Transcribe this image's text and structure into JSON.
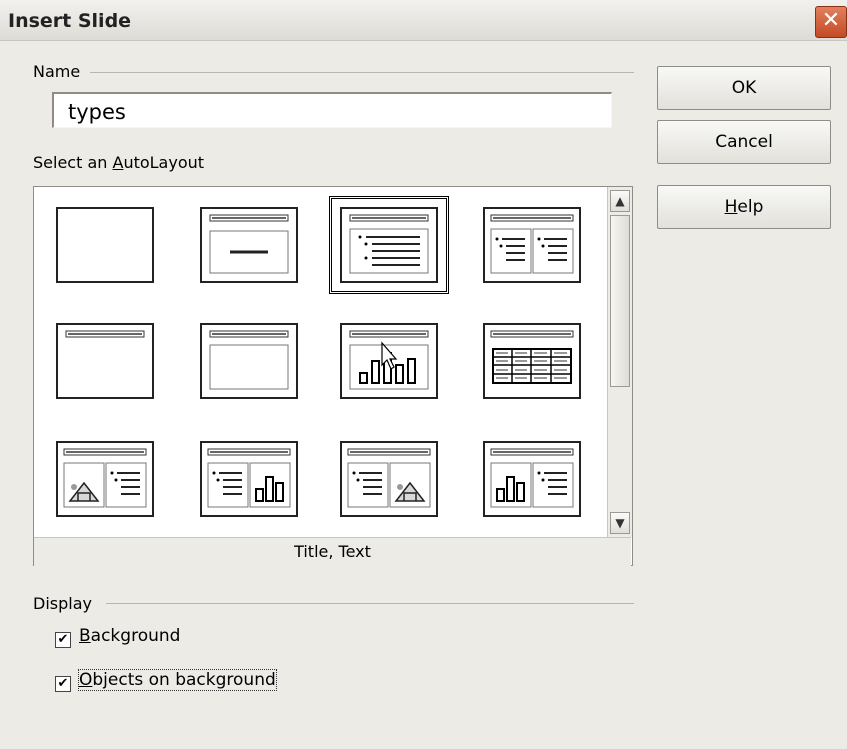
{
  "window": {
    "title": "Insert Slide",
    "close_glyph": "✕"
  },
  "name_group": {
    "label": "Name",
    "value": "types"
  },
  "autolayout": {
    "label_pre": "Select an ",
    "label_accel": "A",
    "label_post": "utoLayout",
    "selected_caption": "Title, Text",
    "layouts": [
      {
        "id": "blank"
      },
      {
        "id": "title-only-centered"
      },
      {
        "id": "title-text"
      },
      {
        "id": "title-2-text"
      },
      {
        "id": "title-only"
      },
      {
        "id": "title-content"
      },
      {
        "id": "title-chart"
      },
      {
        "id": "title-table"
      },
      {
        "id": "title-clipart-text"
      },
      {
        "id": "title-text-chart"
      },
      {
        "id": "title-text-clipart"
      },
      {
        "id": "title-chart-text"
      }
    ],
    "selected_index": 2
  },
  "buttons": {
    "ok": "OK",
    "cancel": "Cancel",
    "help_accel": "H",
    "help_rest": "elp"
  },
  "display_group": {
    "label": "Display",
    "background": {
      "accel": "B",
      "rest": "ackground",
      "checked": true
    },
    "objects": {
      "accel": "O",
      "rest": "bjects on background",
      "checked": true
    }
  },
  "colors": {
    "dialog_bg": "#ecebe6",
    "close_btn": "#c44a25"
  }
}
